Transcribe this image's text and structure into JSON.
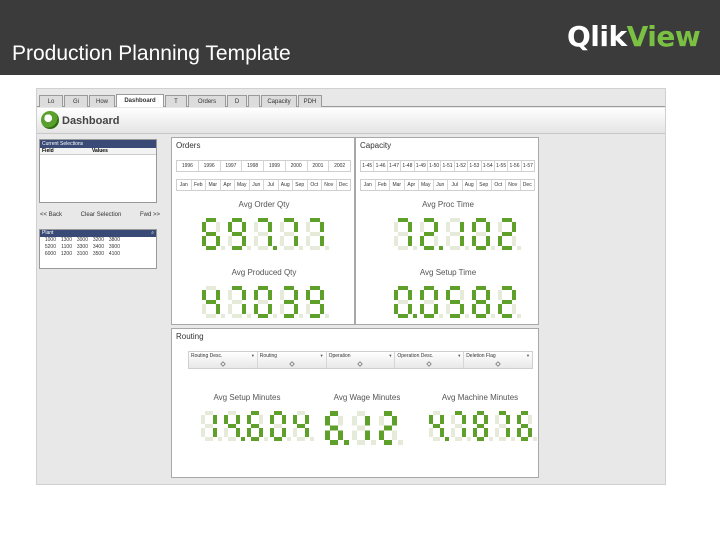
{
  "slide": {
    "title": "Production Planning Template",
    "logo_qlik": "Qlik",
    "logo_view": "View"
  },
  "tabs": [
    {
      "label": "Lo",
      "active": false
    },
    {
      "label": "Gi",
      "active": false
    },
    {
      "label": "How",
      "active": false
    },
    {
      "label": "Dashboard",
      "active": true
    },
    {
      "label": "T",
      "active": false
    },
    {
      "label": "Orders",
      "active": false
    },
    {
      "label": "D",
      "active": false
    },
    {
      "label": "",
      "active": false
    },
    {
      "label": "Capacity",
      "active": false
    },
    {
      "label": "PDH",
      "active": false
    }
  ],
  "dashboard": {
    "title": "Dashboard",
    "current_selections": {
      "caption": "Current Selections",
      "col_field": "Field",
      "col_values": "Values"
    },
    "nav": {
      "back": "<< Back",
      "clear": "Clear Selection",
      "forward": "Fwd >>"
    },
    "plant": {
      "caption": "Plant",
      "rows": [
        [
          "1000",
          "1300",
          "3000",
          "3200",
          "3800"
        ],
        [
          "5200",
          "1100",
          "3300",
          "3400",
          "3900"
        ],
        [
          "6000",
          "1200",
          "3100",
          "3500",
          "4100"
        ]
      ]
    }
  },
  "orders": {
    "title": "Orders",
    "years": [
      "1996",
      "1996",
      "1997",
      "1998",
      "1999",
      "2000",
      "2001",
      "2002"
    ],
    "months": [
      "Jan",
      "Feb",
      "Mar",
      "Apr",
      "May",
      "Jun",
      "Jul",
      "Aug",
      "Sep",
      "Oct",
      "Nov",
      "Dec"
    ],
    "kpis": [
      {
        "label": "Avg Order Qty",
        "value": "697.77"
      },
      {
        "label": "Avg Produced Qty",
        "value": "47039"
      }
    ]
  },
  "capacity": {
    "title": "Capacity",
    "weeks": [
      "1-45",
      "1-46",
      "1-47",
      "1-48",
      "1-49",
      "1-50",
      "1-51",
      "1-52",
      "1-53",
      "1-54",
      "1-55",
      "1-56",
      "1-57"
    ],
    "months": [
      "Jan",
      "Feb",
      "Mar",
      "Apr",
      "May",
      "Jun",
      "Jul",
      "Aug",
      "Sep",
      "Oct",
      "Nov",
      "Dec"
    ],
    "kpis": [
      {
        "label": "Avg Proc Time",
        "value": "72.102"
      },
      {
        "label": "Avg Setup Time",
        "value": "0.0582"
      }
    ]
  },
  "routing": {
    "title": "Routing",
    "columns": [
      "Routing Desc.",
      "Routing",
      "Operation",
      "Operation Desc.",
      "Deletion Flag"
    ],
    "kpis": [
      {
        "label": "Avg Setup Minutes",
        "value": "14.604"
      },
      {
        "label": "Avg Wage Minutes",
        "value": "6.12"
      },
      {
        "label": "Avg Machine Minutes",
        "value": "4.7876"
      }
    ]
  },
  "colors": {
    "header_bg": "#3b3b3b",
    "logo_green": "#7ac043",
    "lcd_on": "#5fa02a",
    "lcd_off": "#e6ead8",
    "caption_bg": "#384a75"
  }
}
